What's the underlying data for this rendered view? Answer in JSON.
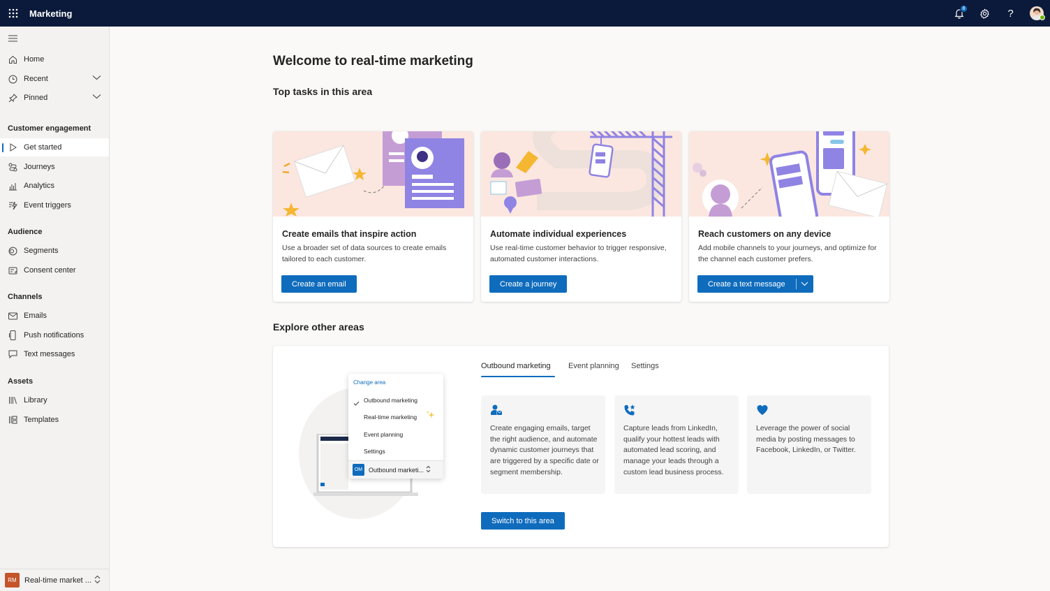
{
  "app": {
    "title": "Marketing",
    "notification_count": "8"
  },
  "sidebar": {
    "top_items": [
      {
        "label": "Home"
      },
      {
        "label": "Recent"
      },
      {
        "label": "Pinned"
      }
    ],
    "sections": [
      {
        "title": "Customer engagement",
        "items": [
          "Get started",
          "Journeys",
          "Analytics",
          "Event triggers"
        ]
      },
      {
        "title": "Audience",
        "items": [
          "Segments",
          "Consent center"
        ]
      },
      {
        "title": "Channels",
        "items": [
          "Emails",
          "Push notifications",
          "Text messages"
        ]
      },
      {
        "title": "Assets",
        "items": [
          "Library",
          "Templates"
        ]
      }
    ],
    "area_switcher": {
      "badge": "RM",
      "label": "Real-time market ..."
    }
  },
  "main": {
    "title": "Welcome to real-time marketing",
    "top_tasks_heading": "Top tasks in this area",
    "cards": [
      {
        "title": "Create emails that inspire action",
        "desc": "Use a broader set of data sources to create emails tailored to each customer.",
        "button": "Create an email"
      },
      {
        "title": "Automate individual experiences",
        "desc": "Use real-time customer behavior to trigger responsive, automated customer interactions.",
        "button": "Create a journey"
      },
      {
        "title": "Reach customers on any device",
        "desc": "Add mobile channels to your journeys, and optimize for the channel each customer prefers.",
        "button": "Create a text message"
      }
    ],
    "explore_heading": "Explore other areas",
    "explore": {
      "tabs": [
        "Outbound marketing",
        "Event planning",
        "Settings"
      ],
      "active_tab": "Outbound marketing",
      "features": [
        {
          "icon": "person-mail-icon",
          "text": "Create engaging emails, target the right audience, and automate dynamic customer journeys that are triggered by a specific date or segment membership."
        },
        {
          "icon": "phone-star-icon",
          "text": "Capture leads from LinkedIn, qualify your hottest leads with automated lead scoring, and manage your leads through a custom lead business process."
        },
        {
          "icon": "heart-icon",
          "text": "Leverage the power of social media by posting messages to Facebook, LinkedIn, or Twitter."
        }
      ],
      "switch_button": "Switch to this area",
      "illustration_menu": {
        "header": "Change area",
        "items": [
          "Outbound marketing",
          "Real-time marketing",
          "Event planning",
          "Settings"
        ],
        "footer_badge": "OM",
        "footer_label": "Outbound marketi..."
      }
    }
  },
  "colors": {
    "accent": "#0f6cbd",
    "topbar": "#0b1a3a",
    "banner": "#fbe7e0"
  }
}
